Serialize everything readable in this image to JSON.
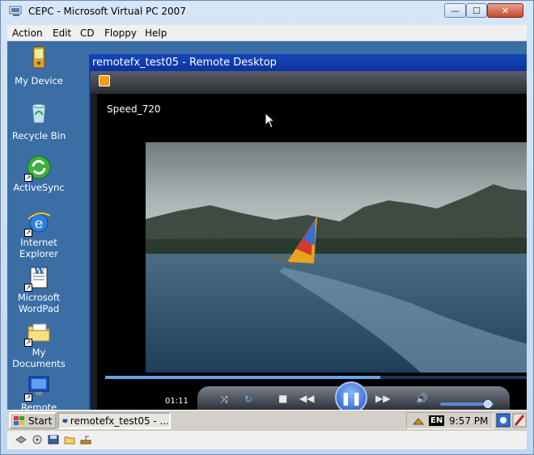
{
  "host_window": {
    "title": "CEPC - Microsoft Virtual PC 2007",
    "menu": [
      "Action",
      "Edit",
      "CD",
      "Floppy",
      "Help"
    ],
    "caption_buttons": {
      "minimize": "—",
      "maximize": "☐",
      "close": "✕"
    }
  },
  "desktop": {
    "icons": [
      {
        "label": "My Device"
      },
      {
        "label": "Recycle Bin"
      },
      {
        "label": "ActiveSync"
      },
      {
        "label": "Internet Explorer"
      },
      {
        "label": "Microsoft WordPad"
      },
      {
        "label": "My Documents"
      },
      {
        "label": "Remote"
      }
    ]
  },
  "rdp_window": {
    "title": "remotefx_test05 - Remote Desktop"
  },
  "media_player": {
    "video_title": "Speed_720",
    "elapsed": "01:11",
    "seek_progress": 0.65,
    "volume_level": 0.9
  },
  "taskbar": {
    "start_label": "Start",
    "task_label": "remotefx_test05 - ...",
    "language": "EN",
    "clock": "9:57 PM"
  }
}
